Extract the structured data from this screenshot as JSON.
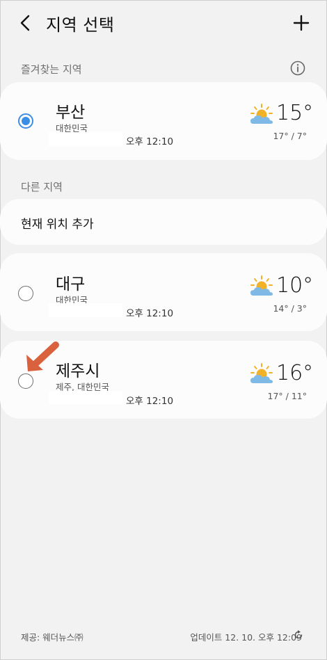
{
  "header": {
    "title": "지역 선택"
  },
  "favorites": {
    "label": "즐겨찾는 지역",
    "items": [
      {
        "city": "부산",
        "country": "대한민국",
        "time": "오후 12:10",
        "temp": "15°",
        "range": "17° / 7°",
        "selected": true,
        "icon": "partly-cloudy-icon"
      }
    ]
  },
  "others": {
    "label": "다른 지역",
    "add_current": "현재 위치 추가",
    "items": [
      {
        "city": "대구",
        "country": "대한민국",
        "time": "오후 12:10",
        "temp": "10°",
        "range": "14° / 3°",
        "selected": false,
        "icon": "partly-cloudy-icon"
      },
      {
        "city": "제주시",
        "country": "제주, 대한민국",
        "time": "오후 12:10",
        "temp": "16°",
        "range": "17° / 11°",
        "selected": false,
        "icon": "partly-cloudy-icon"
      }
    ]
  },
  "footer": {
    "provider": "제공: 웨더뉴스㈜",
    "updated": "업데이트 12. 10. 오후 12:09"
  },
  "colors": {
    "accent": "#3b8ee6",
    "annotation_arrow": "#d9613e",
    "sun": "#f2b227",
    "cloud": "#7fb9e6"
  }
}
